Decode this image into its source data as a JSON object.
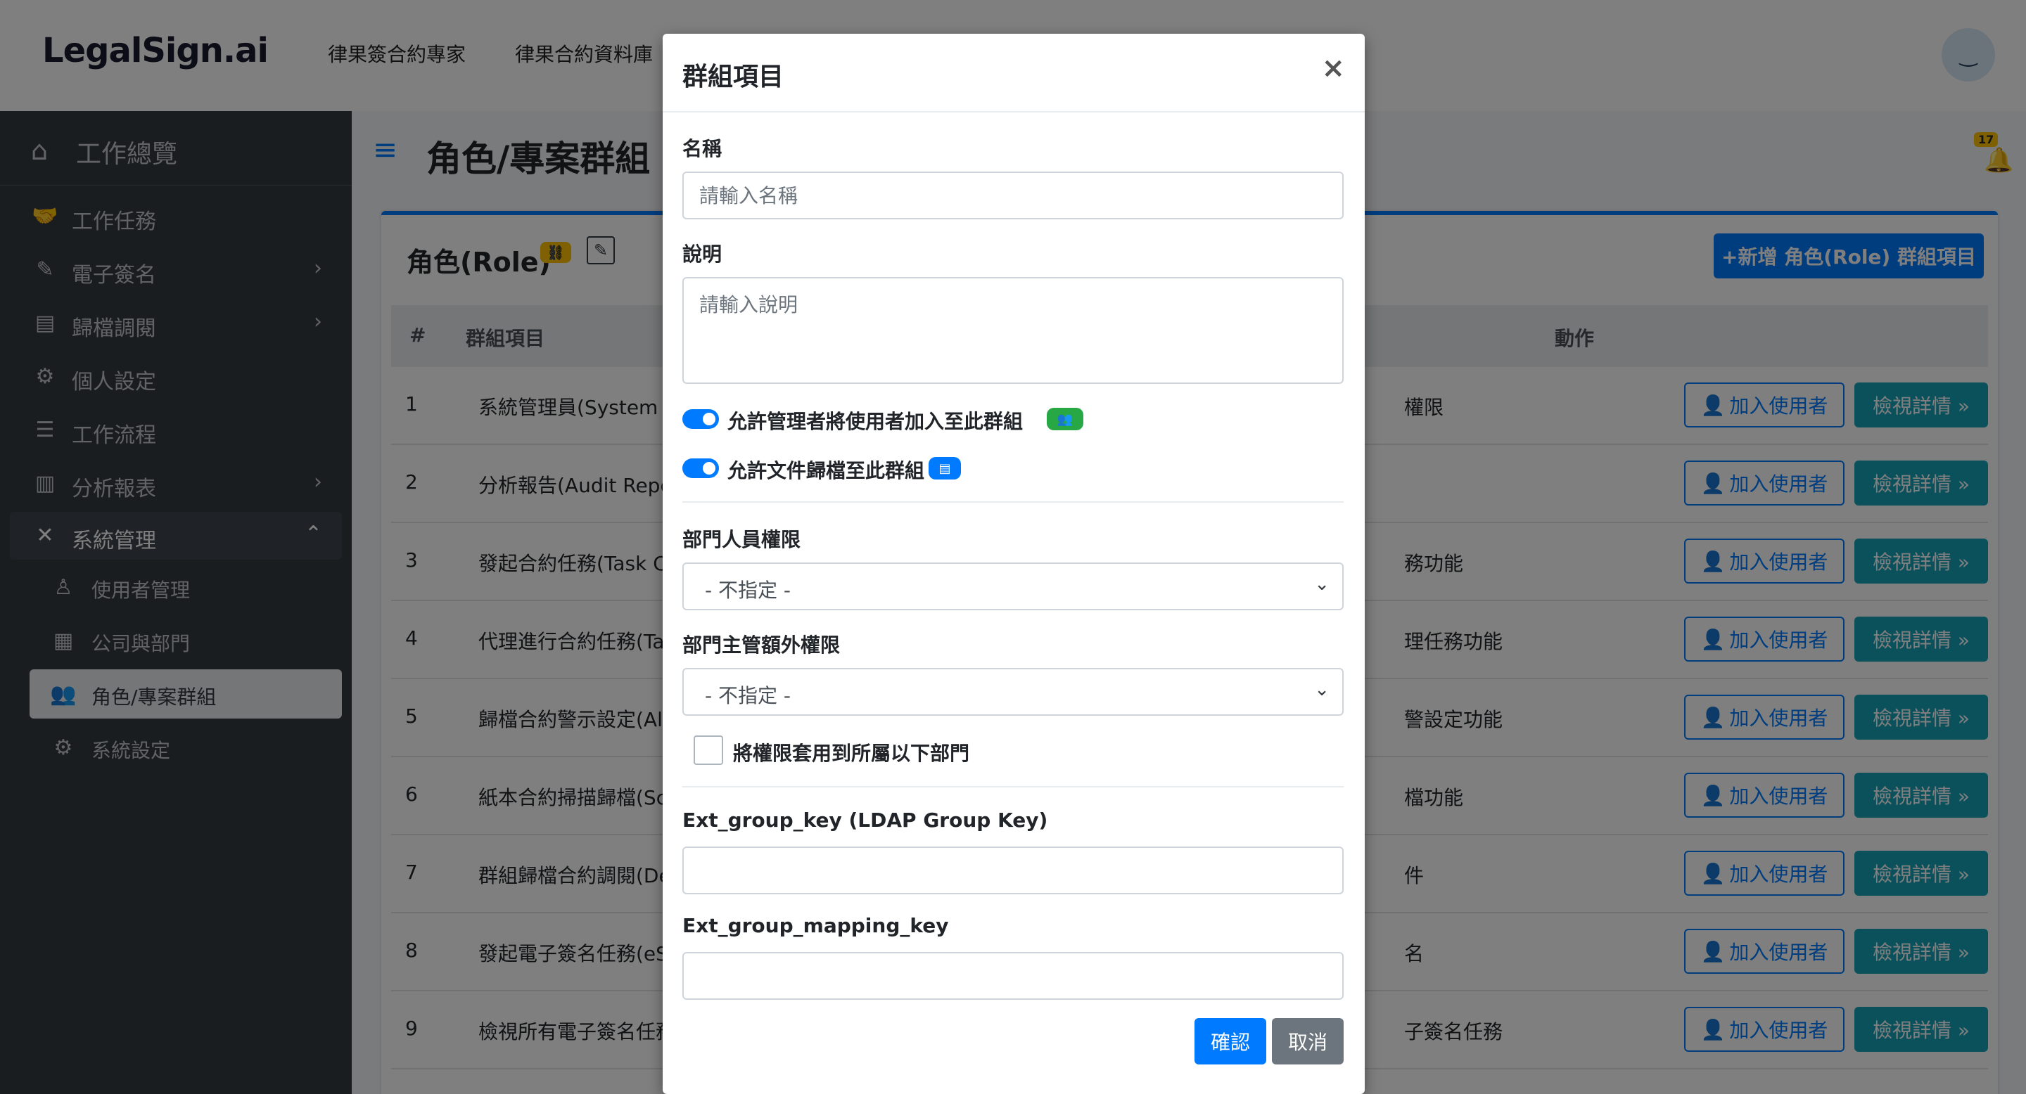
{
  "navbar": {
    "brand": "LegalSign.ai",
    "links": [
      "律果簽合約專家",
      "律果合約資料庫"
    ],
    "avatar_icon": "smiley-face-icon"
  },
  "sidebar": {
    "header": "工作總覽",
    "items": [
      {
        "label": "工作任務",
        "icon": "handshake-icon",
        "arrow": ""
      },
      {
        "label": "電子簽名",
        "icon": "signature-icon",
        "arrow": "›"
      },
      {
        "label": "歸檔調閱",
        "icon": "archive-icon",
        "arrow": "›"
      },
      {
        "label": "個人設定",
        "icon": "user-cog-icon",
        "arrow": ""
      },
      {
        "label": "工作流程",
        "icon": "tasks-icon",
        "arrow": ""
      },
      {
        "label": "分析報表",
        "icon": "chart-icon",
        "arrow": "›"
      },
      {
        "label": "系統管理",
        "icon": "tools-icon",
        "arrow": "⌃"
      }
    ],
    "sub_items": [
      {
        "label": "使用者管理",
        "icon": "user-icon"
      },
      {
        "label": "公司與部門",
        "icon": "building-icon"
      },
      {
        "label": "角色/專案群組",
        "icon": "users-icon"
      },
      {
        "label": "系統設定",
        "icon": "gear-icon"
      }
    ]
  },
  "content": {
    "page_title": "角色/專案群組",
    "notification_count": "17",
    "card": {
      "title": "角色(Role)",
      "add_button": "+新增 角色(Role) 群組項目",
      "columns": {
        "num": "#",
        "name": "群組項目",
        "action": "動作"
      },
      "add_user_label": "加入使用者",
      "view_label": "檢視詳情 »",
      "rows": [
        {
          "num": "1",
          "name": "系統管理員(System Ac",
          "desc": "權限"
        },
        {
          "num": "2",
          "name": "分析報告(Audit Report",
          "desc": ""
        },
        {
          "num": "3",
          "name": "發起合約任務(Task Cre",
          "desc": "務功能"
        },
        {
          "num": "4",
          "name": "代理進行合約任務(Tas",
          "desc": "理任務功能"
        },
        {
          "num": "5",
          "name": "歸檔合約警示設定(Aler",
          "desc": "警設定功能"
        },
        {
          "num": "6",
          "name": "紙本合約掃描歸檔(Sca",
          "desc": "檔功能"
        },
        {
          "num": "7",
          "name": "群組歸檔合約調閱(Dep",
          "desc": "件"
        },
        {
          "num": "8",
          "name": "發起電子簽名任務(eSig",
          "desc": "名"
        },
        {
          "num": "9",
          "name": "檢視所有電子簽名任務",
          "desc": "子簽名任務"
        }
      ]
    }
  },
  "modal": {
    "title": "群組項目",
    "close": "×",
    "name_label": "名稱",
    "name_placeholder": "請輸入名稱",
    "name_value": "",
    "desc_label": "說明",
    "desc_placeholder": "請輸入說明",
    "desc_value": "",
    "switch_add_users": "允許管理者將使用者加入至此群組",
    "switch_archive": "允許文件歸檔至此群組",
    "dept_perm_label": "部門人員權限",
    "dept_perm_value": "- 不指定 -",
    "mgr_perm_label": "部門主管額外權限",
    "mgr_perm_value": "- 不指定 -",
    "apply_sub_label": "將權限套用到所屬以下部門",
    "ext_key_label": "Ext_group_key (LDAP Group Key)",
    "ext_key_value": "",
    "ext_mapping_label": "Ext_group_mapping_key",
    "ext_mapping_value": "",
    "confirm": "確認",
    "cancel": "取消"
  },
  "colors": {
    "primary": "#007bff",
    "info": "#17a2b8",
    "success": "#28a745",
    "warning": "#ffc107",
    "secondary": "#6c757d",
    "sidebar": "#343a40"
  }
}
